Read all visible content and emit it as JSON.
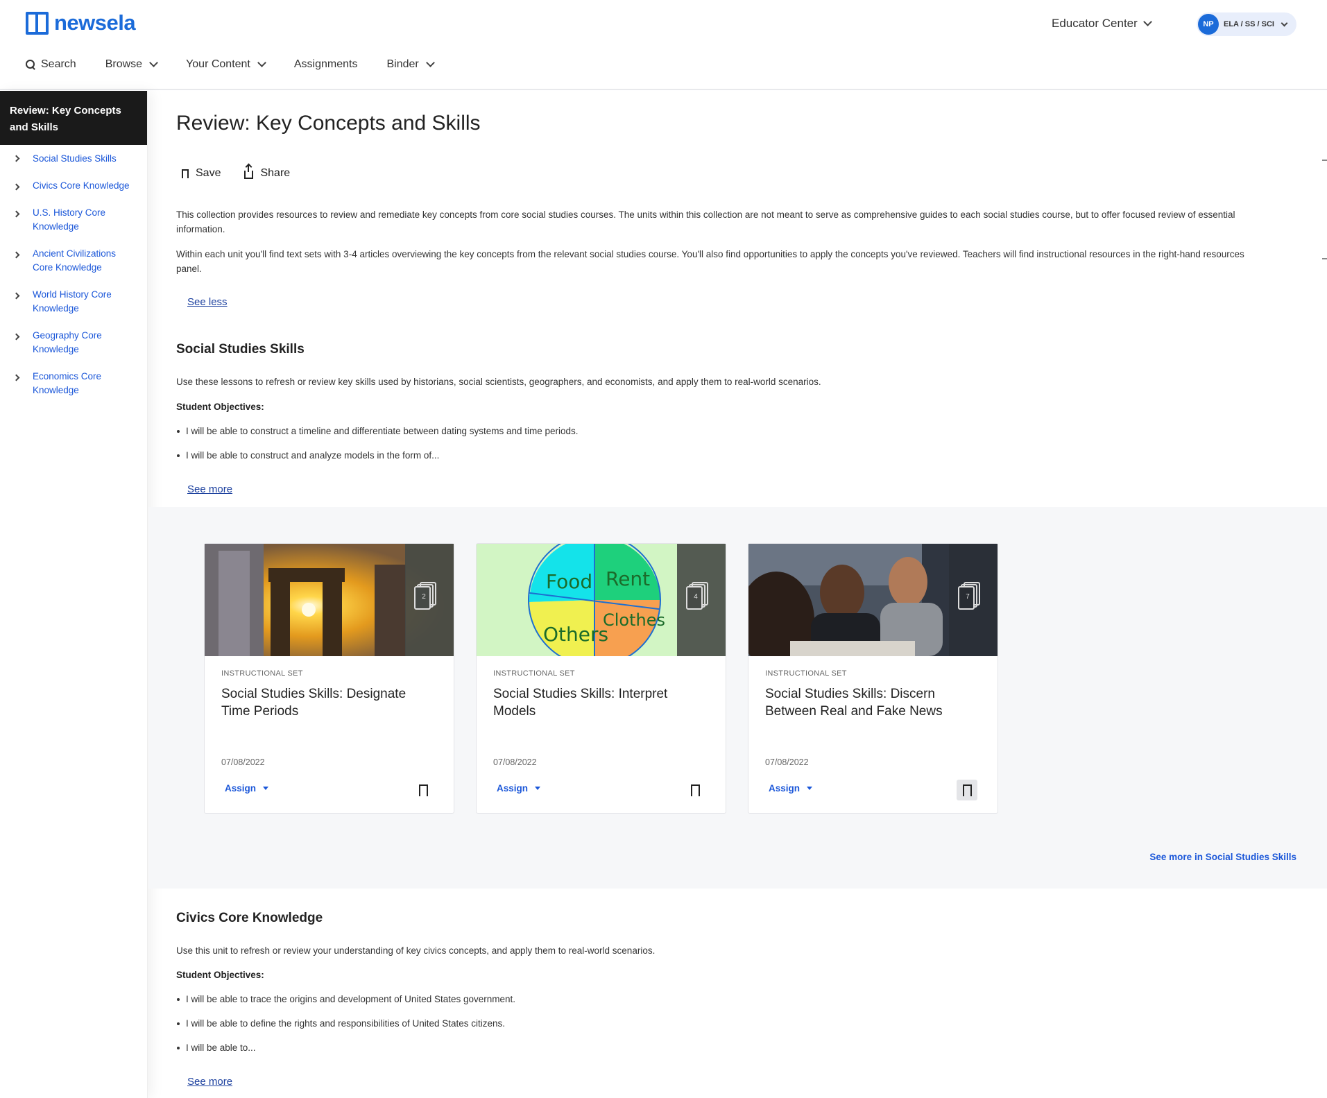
{
  "header": {
    "logo_text": "newsela",
    "educator_center": "Educator Center",
    "profile_initials": "NP",
    "profile_label": "ELA / SS / SCI",
    "nav": {
      "search": "Search",
      "browse": "Browse",
      "your_content": "Your Content",
      "assignments": "Assignments",
      "binder": "Binder"
    }
  },
  "sidebar": {
    "title": "Review: Key Concepts and Skills",
    "items": [
      {
        "label": "Social Studies Skills"
      },
      {
        "label": "Civics Core Knowledge"
      },
      {
        "label": "U.S. History Core Knowledge"
      },
      {
        "label": "Ancient Civilizations Core Knowledge"
      },
      {
        "label": "World History Core Knowledge"
      },
      {
        "label": "Geography Core Knowledge"
      },
      {
        "label": "Economics Core Knowledge"
      }
    ]
  },
  "main": {
    "title": "Review: Key Concepts and Skills",
    "save_label": "Save",
    "share_label": "Share",
    "intro_p1": "This collection provides resources to review and remediate key concepts from core social studies courses. The units within this collection are not meant to serve as comprehensive guides to each social studies course, but to offer focused review of essential information.",
    "intro_p2": "Within each unit you'll find text sets with 3-4 articles overviewing the key concepts from the relevant social studies course. You'll also find opportunities to apply the concepts you've reviewed. Teachers will find instructional resources in the right-hand resources panel.",
    "see_less": "See less",
    "sections": [
      {
        "title": "Social Studies Skills",
        "description": "Use these lessons to refresh or review key skills used by historians, social scientists, geographers, and economists, and apply them to real-world scenarios.",
        "objectives_label": "Student Objectives:",
        "objectives": [
          "I will be able to construct a timeline and differentiate between dating systems and time periods.",
          "I will be able to construct and analyze models in the form of..."
        ],
        "see_more": "See more",
        "see_more_in": "See more in Social Studies Skills",
        "cards": [
          {
            "type": "INSTRUCTIONAL SET",
            "title": "Social Studies Skills: Designate Time Periods",
            "date": "07/08/2022",
            "count": "2",
            "assign": "Assign"
          },
          {
            "type": "INSTRUCTIONAL SET",
            "title": "Social Studies Skills: Interpret Models",
            "date": "07/08/2022",
            "count": "4",
            "assign": "Assign",
            "pie_labels": [
              "Food",
              "Rent",
              "Others",
              "Clothes"
            ]
          },
          {
            "type": "INSTRUCTIONAL SET",
            "title": "Social Studies Skills: Discern Between Real and Fake News",
            "date": "07/08/2022",
            "count": "7",
            "assign": "Assign"
          }
        ]
      },
      {
        "title": "Civics Core Knowledge",
        "description": "Use this unit to refresh or review your understanding of key civics concepts, and apply them to real-world scenarios.",
        "objectives_label": "Student Objectives:",
        "objectives": [
          "I will be able to trace the origins and development of United States government.",
          "I will be able to define the rights and responsibilities of United States citizens.",
          "I will be able to..."
        ],
        "see_more": "See more"
      }
    ]
  },
  "colors": {
    "brand": "#1b6bd9",
    "link": "#1b57d9",
    "sidebar_header": "#1a1a1a",
    "band_bg": "#f6f7f9"
  }
}
